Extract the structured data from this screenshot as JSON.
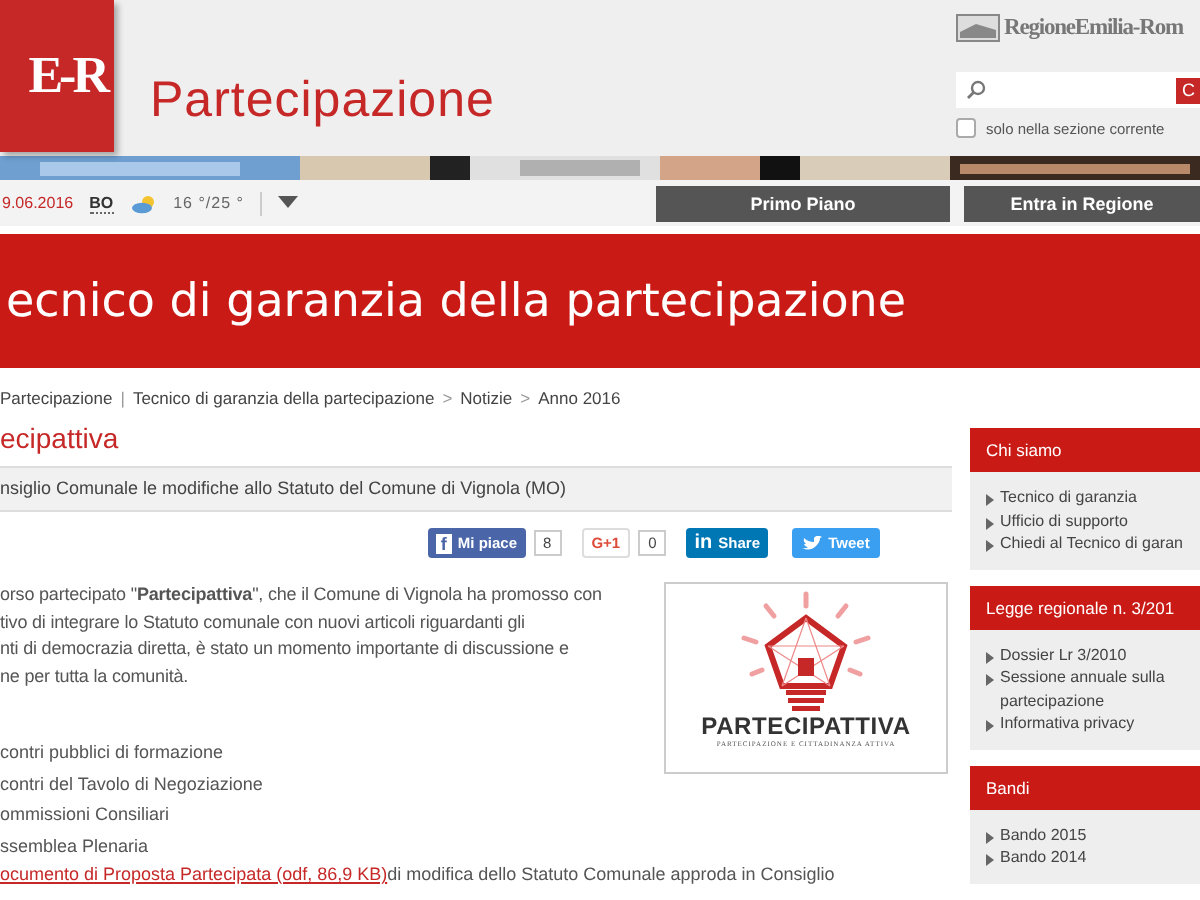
{
  "header": {
    "logo": "E-R",
    "site_title": "Partecipazione",
    "region_logo": "RegioneEmilia-Rom",
    "search": {
      "button": "C"
    },
    "scope_option": {
      "label": "solo nella sezione corrente",
      "checked": false
    }
  },
  "toolbar": {
    "date": "9.06.2016",
    "city": "BO",
    "temperature": "16 °/25 °",
    "buttons": [
      "Primo Piano",
      "Entra in Regione"
    ]
  },
  "page_title": "ecnico di garanzia della partecipazione",
  "breadcrumb": [
    {
      "kind": "link",
      "text": "Partecipazione"
    },
    {
      "kind": "separator",
      "text": "|"
    },
    {
      "kind": "link",
      "text": "Tecnico di garanzia della partecipazione"
    },
    {
      "kind": "separator",
      "text": ">"
    },
    {
      "kind": "link",
      "text": "Notizie"
    },
    {
      "kind": "separator",
      "text": ">"
    },
    {
      "kind": "link",
      "text": "Anno 2016"
    }
  ],
  "article": {
    "title": "ecipattiva",
    "subtitle": "nsiglio Comunale le modifiche allo Statuto del Comune di Vignola (MO)",
    "social": [
      {
        "kind": "facebook",
        "icon": "f",
        "label": "Mi piace",
        "count": "8"
      },
      {
        "kind": "gplus",
        "label": "G+1",
        "count": "0"
      },
      {
        "kind": "linkedin",
        "icon": "in",
        "label": "Share"
      },
      {
        "kind": "twitter",
        "label": "Tweet"
      }
    ],
    "paragraph_lines": [
      "orso partecipato \"**Partecipattiva**\", che il Comune di Vignola ha promosso con",
      "tivo di integrare lo Statuto comunale con nuovi articoli riguardanti gli",
      "nti di democrazia diretta, è stato un momento importante di discussione e",
      "ne per tutta la comunità."
    ],
    "logo": {
      "name": "PARTECIPATTIVA",
      "tagline": "PARTECIPAZIONE E CITTADINANZA ATTIVA"
    },
    "list": [
      "contri pubblici di formazione",
      "contri del Tavolo di Negoziazione",
      "ommissioni Consiliari",
      "ssemblea Plenaria"
    ],
    "document_link": "ocumento di Proposta Partecipata (odf, 86,9 KB)",
    "document_rest": "di modifica dello Statuto Comunale approda in Consiglio"
  },
  "sidebar": [
    {
      "title": "Chi siamo",
      "items": [
        "Tecnico di garanzia",
        "Ufficio di supporto",
        "Chiedi al Tecnico di garan"
      ]
    },
    {
      "title": "Legge regionale n. 3/201",
      "items": [
        "Dossier Lr 3/2010",
        "Sessione annuale sulla partecipazione",
        "Informativa privacy"
      ]
    },
    {
      "title": "Bandi",
      "items": [
        "Bando 2015",
        "Bando 2014"
      ]
    }
  ]
}
